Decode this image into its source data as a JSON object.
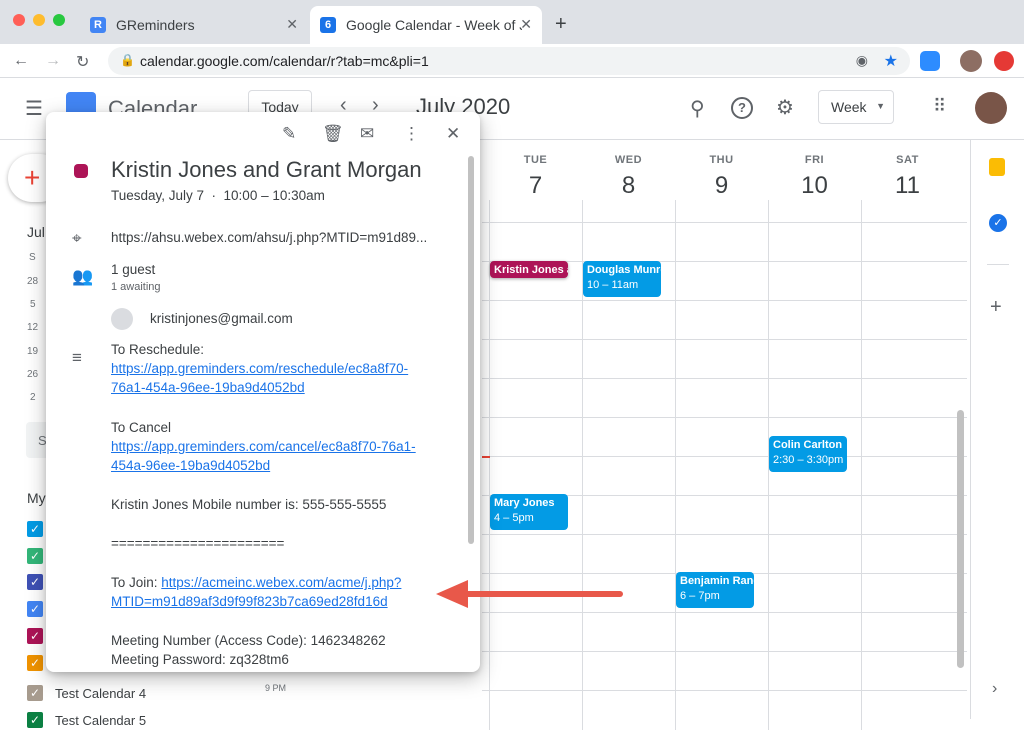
{
  "browser": {
    "tabs": [
      {
        "title": "GReminders",
        "favicon": "R",
        "active": false
      },
      {
        "title": "Google Calendar - Week of Jul",
        "favicon": "6",
        "active": true
      }
    ],
    "url": "calendar.google.com/calendar/r?tab=mc&pli=1"
  },
  "header": {
    "app_name": "Calendar",
    "today": "Today",
    "month_title": "July 2020",
    "view": "Week"
  },
  "days": [
    {
      "name": "TUE",
      "num": "7"
    },
    {
      "name": "WED",
      "num": "8"
    },
    {
      "name": "THU",
      "num": "9"
    },
    {
      "name": "FRI",
      "num": "10"
    },
    {
      "name": "SAT",
      "num": "11"
    }
  ],
  "events": [
    {
      "title": "Kristin Jones a",
      "time": "",
      "color": "#ad1457"
    },
    {
      "title": "Douglas Munre",
      "time": "10 – 11am",
      "color": "#039be5"
    },
    {
      "title": "Colin Carlton",
      "time": "2:30 – 3:30pm",
      "color": "#039be5"
    },
    {
      "title": "Mary Jones",
      "time": "4 – 5pm",
      "color": "#039be5"
    },
    {
      "title": "Benjamin Rand",
      "time": "6 – 7pm",
      "color": "#039be5"
    }
  ],
  "sidebar": {
    "mini_month": "Jul",
    "mini_rows": [
      "S",
      "28",
      "5",
      "12",
      "19",
      "26",
      "2"
    ],
    "search_initial": "S",
    "my_calendars": "My",
    "calendars": [
      {
        "label": "",
        "color": "#039be5"
      },
      {
        "label": "",
        "color": "#33b679"
      },
      {
        "label": "",
        "color": "#3f51b5"
      },
      {
        "label": "",
        "color": "#4285f4"
      },
      {
        "label": "",
        "color": "#ad1457"
      },
      {
        "label": "",
        "color": "#f09300"
      },
      {
        "label": "Test Calendar 4",
        "color": "#a79b8e"
      },
      {
        "label": "Test Calendar 5",
        "color": "#0b8043"
      }
    ],
    "time_label": "9 PM"
  },
  "popup": {
    "title": "Kristin Jones and Grant Morgan",
    "when": "Tuesday, July 7  ·  10:00 – 10:30am",
    "location": "https://ahsu.webex.com/ahsu/j.php?MTID=m91d89...",
    "guests_count": "1 guest",
    "guests_status": "1 awaiting",
    "guest_email": "kristinjones@gmail.com",
    "desc": {
      "reschedule_label": "To Reschedule:",
      "reschedule_link_1": "https://app.greminders.com/reschedule/ec8a8f70-",
      "reschedule_link_2": "76a1-454a-96ee-19ba9d4052bd",
      "cancel_label": "To Cancel",
      "cancel_link_1": "https://app.greminders.com/cancel/ec8a8f70-76a1-",
      "cancel_link_2": "454a-96ee-19ba9d4052bd",
      "mobile": "Kristin Jones Mobile number is: 555-555-5555",
      "separator": "======================",
      "join_label": "To Join: ",
      "join_link_1": "https://acmeinc.webex.com/acme/j.php?",
      "join_link_2": "MTID=m91d89af3d9f99f823b7ca69ed28fd16d",
      "meeting_number": "Meeting Number (Access Code): 1462348262",
      "meeting_password": "Meeting Password: zq328tm6"
    }
  },
  "colors": {
    "accent": "#1a73e8",
    "arrow": "#e8584a",
    "event_blue": "#039be5",
    "event_magenta": "#ad1457"
  }
}
